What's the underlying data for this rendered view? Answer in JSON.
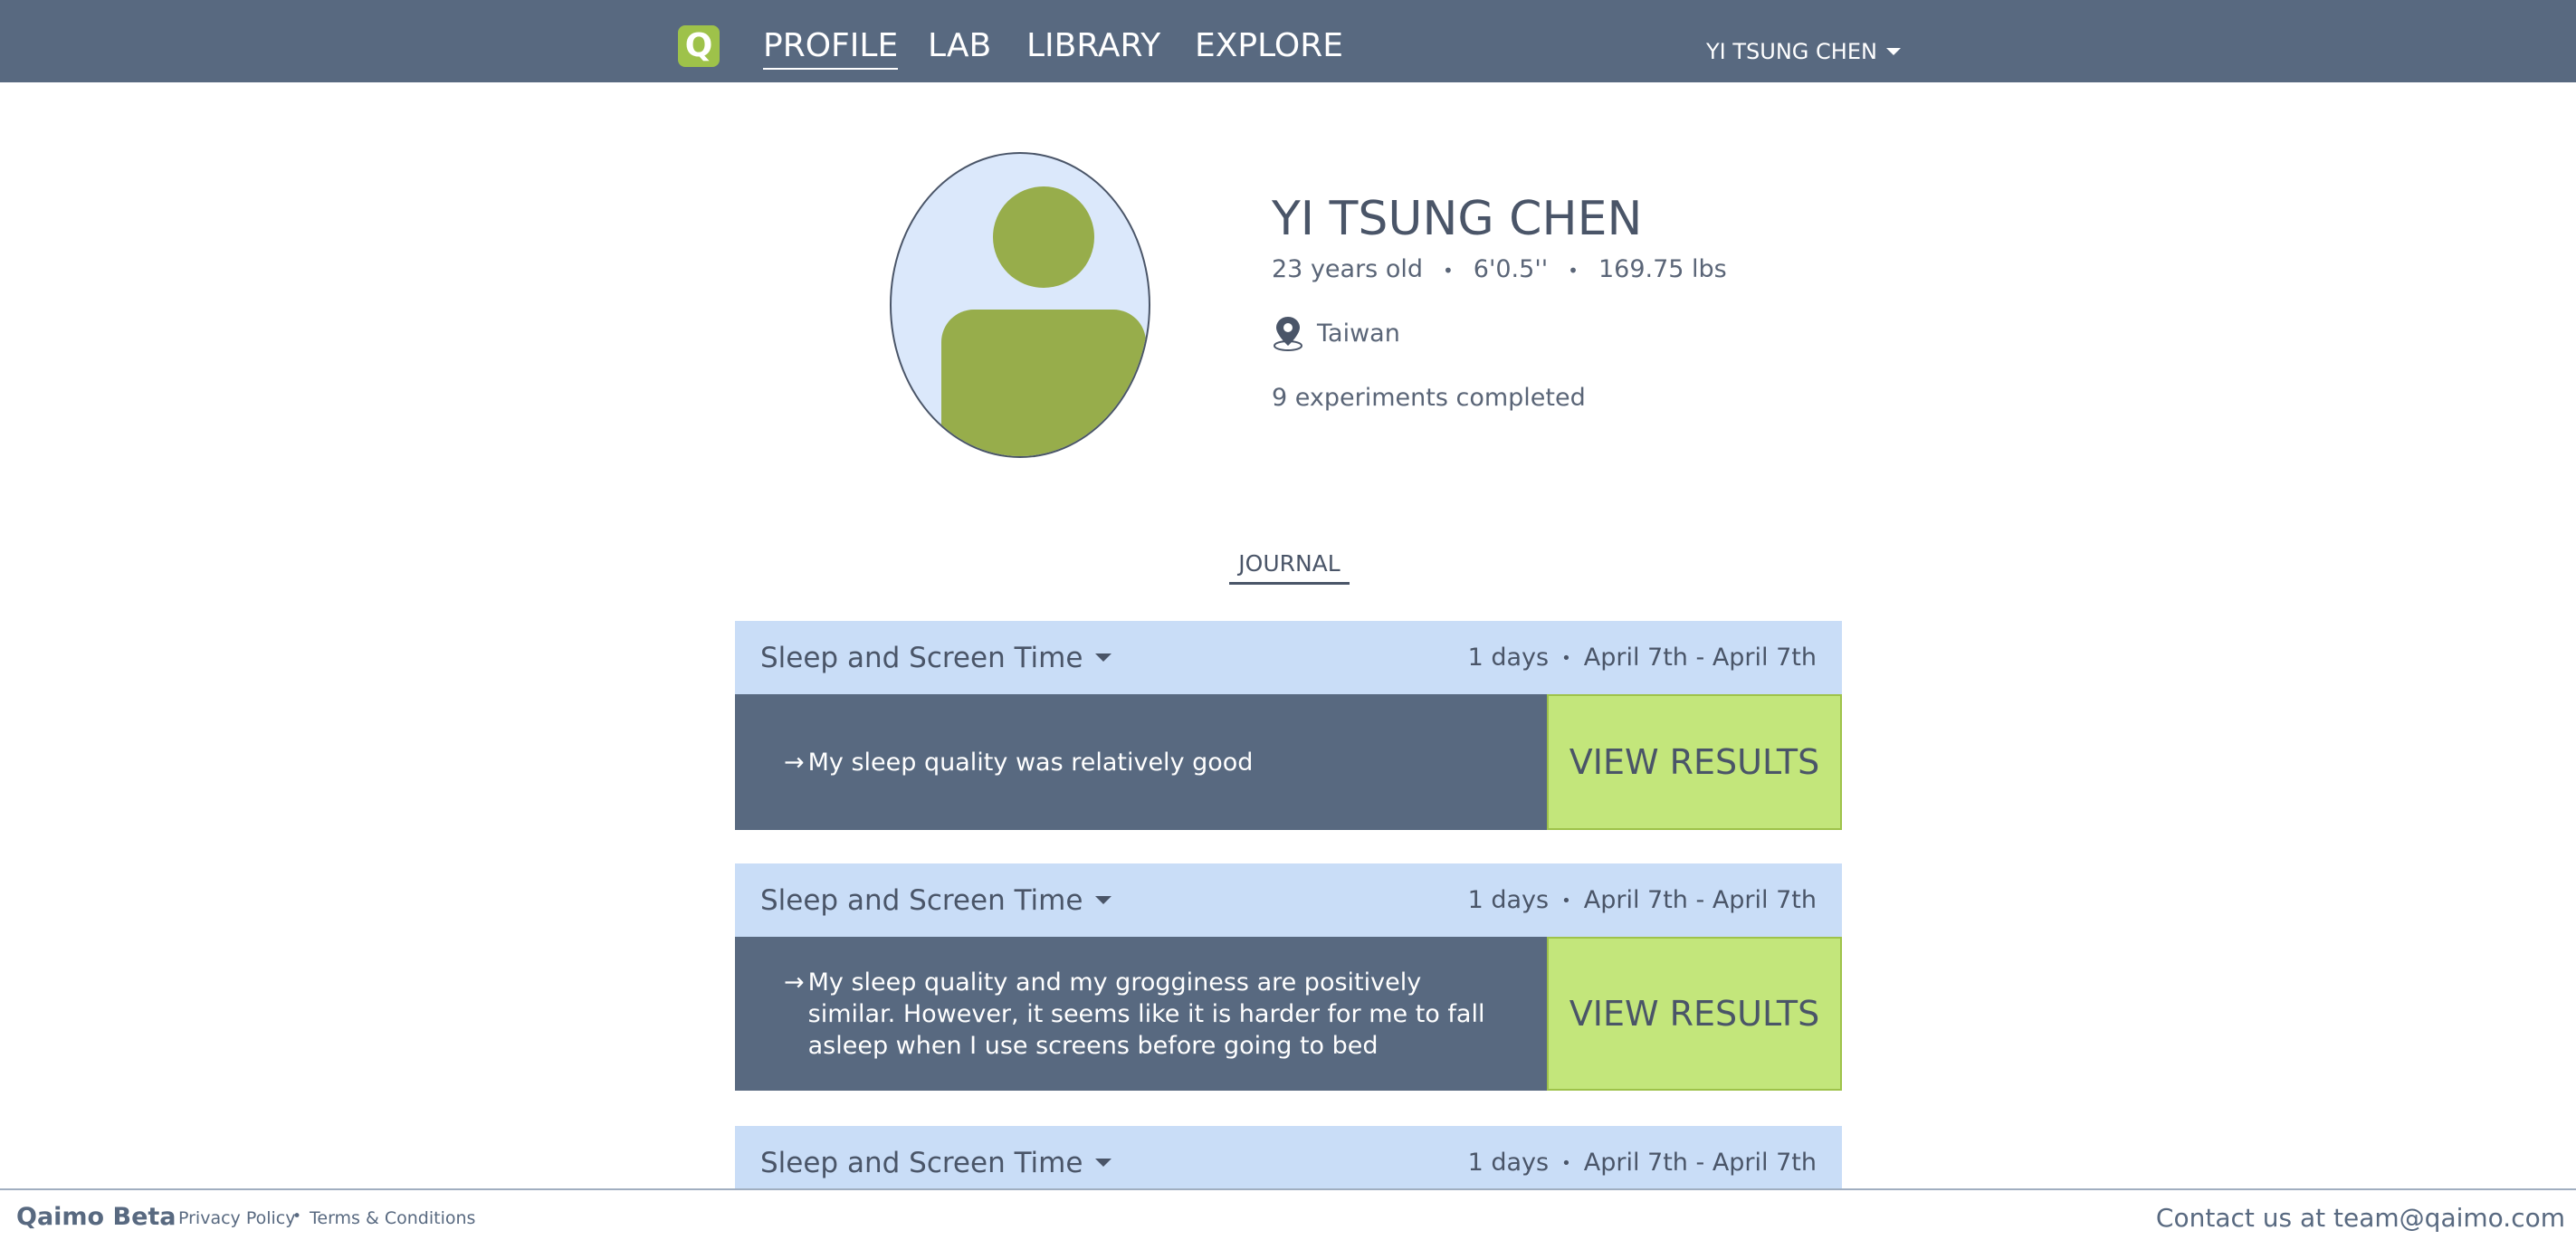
{
  "nav": {
    "logo_letter": "Q",
    "items": [
      {
        "label": "PROFILE",
        "active": true
      },
      {
        "label": "LAB",
        "active": false
      },
      {
        "label": "LIBRARY",
        "active": false
      },
      {
        "label": "EXPLORE",
        "active": false
      }
    ],
    "user_name": "YI TSUNG CHEN"
  },
  "profile": {
    "name": "YI TSUNG CHEN",
    "age": "23 years old",
    "height": "6'0.5''",
    "weight": "169.75 lbs",
    "location": "Taiwan",
    "experiments": "9 experiments completed"
  },
  "journal": {
    "tab_label": "JOURNAL",
    "entries": [
      {
        "title": "Sleep and Screen Time",
        "duration": "1 days",
        "dates": "April 7th - April 7th",
        "arrow": "→",
        "note": "My sleep quality was relatively good",
        "button": "VIEW RESULTS"
      },
      {
        "title": "Sleep and Screen Time",
        "duration": "1 days",
        "dates": "April 7th - April 7th",
        "arrow": "→",
        "note": "My sleep quality and my grogginess are positively similar. However, it seems like it is harder for me to fall asleep when I use screens before going to bed",
        "button": "VIEW RESULTS"
      },
      {
        "title": "Sleep and Screen Time",
        "duration": "1 days",
        "dates": "April 7th - April 7th"
      }
    ]
  },
  "footer": {
    "brand": "Qaimo Beta",
    "privacy": "Privacy Policy",
    "terms": "Terms & Conditions",
    "contact": "Contact us at team@qaimo.com"
  },
  "colors": {
    "nav_bg": "#586980",
    "accent_green": "#97ad4b",
    "button_green": "#c3e67b",
    "card_header": "#c9ddf7"
  },
  "icons": [
    "logo-icon",
    "caret-down-icon",
    "location-pin-icon",
    "user-avatar-icon"
  ]
}
